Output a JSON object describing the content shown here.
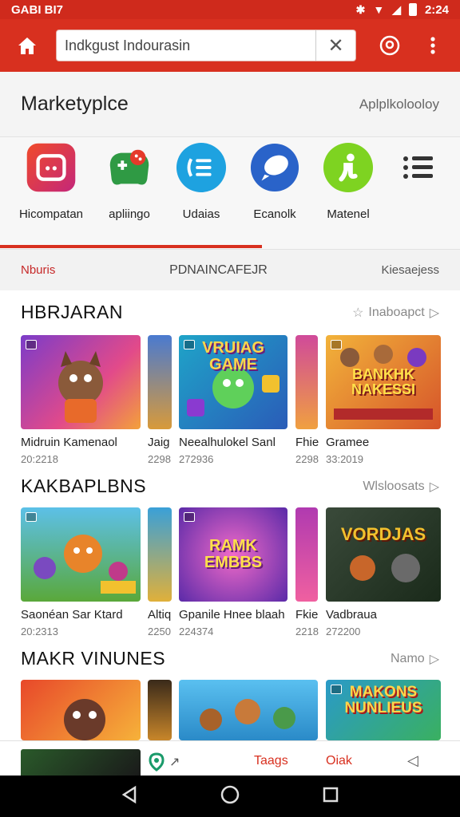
{
  "status_bar": {
    "left_text": "GABI BI7",
    "time": "2:24"
  },
  "search": {
    "value": "Indkgust Indourasin"
  },
  "market": {
    "title": "Marketyplce",
    "link": "Aplplkolooloy"
  },
  "categories": [
    {
      "label": "Hicompatan",
      "icon": "grid-app-icon",
      "color": "#e83a2f"
    },
    {
      "label": "apliingo",
      "icon": "gamepad-icon",
      "color": "#2f9a44"
    },
    {
      "label": "Udaias",
      "icon": "list-app-icon",
      "color": "#1ea2e0"
    },
    {
      "label": "Ecanolk",
      "icon": "chat-bubble-icon",
      "color": "#2a63c9"
    },
    {
      "label": "Matenel",
      "icon": "info-icon",
      "color": "#7ed321"
    },
    {
      "label": "",
      "icon": "more-menu-icon",
      "color": "#333333"
    }
  ],
  "subtabs": {
    "left": "Nburis",
    "center": "PDNAINCAFEJR",
    "right": "Kiesaejess"
  },
  "sections": [
    {
      "title": "HBRJARAN",
      "link": "Inaboapct",
      "items": [
        {
          "title": "Midruin Kamenaol",
          "meta": "20:2218",
          "art": ""
        },
        {
          "title": "Jaig",
          "meta": "2298",
          "art": ""
        },
        {
          "title": "Neealhulokel Sanl",
          "meta": "272936",
          "art": "VRUIAG GAME"
        },
        {
          "title": "Fhie",
          "meta": "2298",
          "art": ""
        },
        {
          "title": "Gramee",
          "meta": "33:2019",
          "art": "BANKHK NAKESSI"
        }
      ]
    },
    {
      "title": "KAKBAPLBNS",
      "link": "Wlsloosats",
      "items": [
        {
          "title": "Saonéan Sar Ktard",
          "meta": "20:2313",
          "art": ""
        },
        {
          "title": "Altiq",
          "meta": "2250",
          "art": ""
        },
        {
          "title": "Gpanile Hnee blaah",
          "meta": "224374",
          "art": "RAMK EMBBS"
        },
        {
          "title": "Fkie",
          "meta": "2218",
          "art": ""
        },
        {
          "title": "Vadbraua",
          "meta": "272200",
          "art": "VORDJAS"
        }
      ]
    },
    {
      "title": "MAKR VINUNES",
      "link": "Namo",
      "items": [
        {
          "title": "",
          "meta": "",
          "art": ""
        },
        {
          "title": "",
          "meta": "",
          "art": ""
        },
        {
          "title": "",
          "meta": "",
          "art": ""
        },
        {
          "title": "",
          "meta": "",
          "art": "MAKONS NUNLIEUS"
        }
      ]
    }
  ],
  "bottom_nav": {
    "tab1": "Taags",
    "tab2": "Oiak"
  }
}
